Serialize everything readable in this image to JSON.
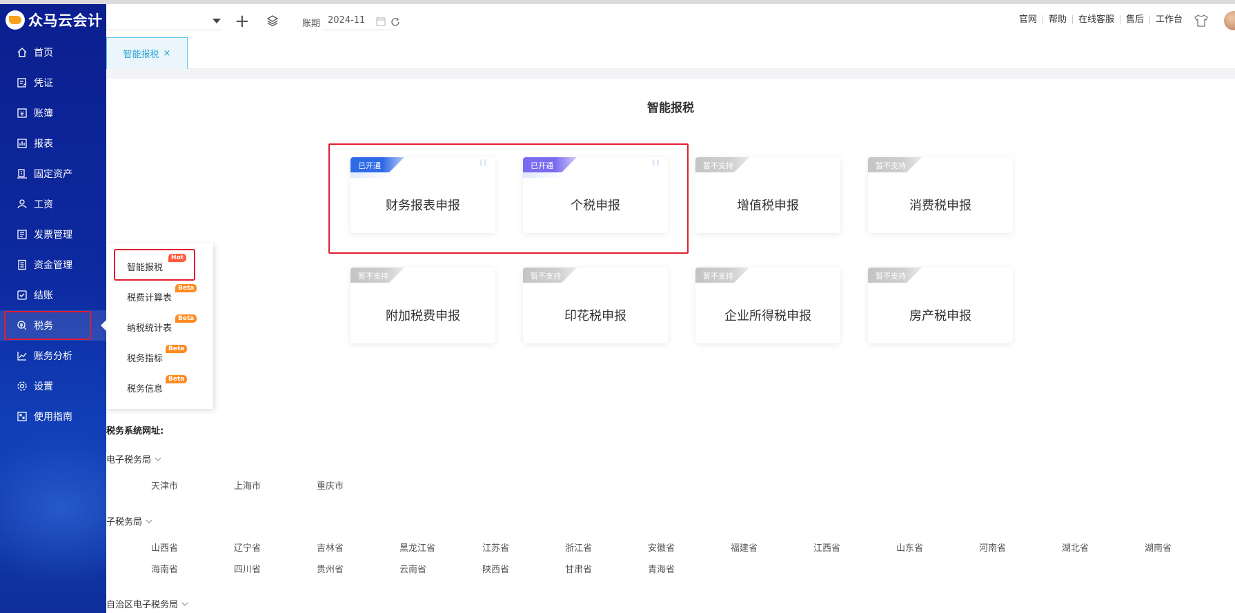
{
  "app": {
    "brand": "众马云会计"
  },
  "sidebar": {
    "items": [
      {
        "label": "首页",
        "icon": "home-icon"
      },
      {
        "label": "凭证",
        "icon": "voucher-icon"
      },
      {
        "label": "账簿",
        "icon": "ledger-icon"
      },
      {
        "label": "报表",
        "icon": "report-icon"
      },
      {
        "label": "固定资产",
        "icon": "asset-icon"
      },
      {
        "label": "工资",
        "icon": "salary-icon"
      },
      {
        "label": "发票管理",
        "icon": "invoice-icon"
      },
      {
        "label": "资金管理",
        "icon": "fund-icon"
      },
      {
        "label": "结账",
        "icon": "closing-icon"
      },
      {
        "label": "税务",
        "icon": "tax-icon",
        "active": true
      },
      {
        "label": "账务分析",
        "icon": "analysis-icon"
      },
      {
        "label": "设置",
        "icon": "gear-icon"
      },
      {
        "label": "使用指南",
        "icon": "guide-icon"
      }
    ]
  },
  "header": {
    "period_label": "账期",
    "period_value": "2024-11",
    "links": [
      "官网",
      "帮助",
      "在线客服",
      "售后",
      "工作台"
    ]
  },
  "tabs": [
    {
      "label": "智能报税",
      "close": "×"
    }
  ],
  "main": {
    "title": "智能报税",
    "cards": [
      {
        "label": "财务报表申报",
        "status": "已开通"
      },
      {
        "label": "个税申报",
        "status": "已开通"
      },
      {
        "label": "增值税申报",
        "status": "暂不支持"
      },
      {
        "label": "消费税申报",
        "status": "暂不支持"
      },
      {
        "label": "附加税费申报",
        "status": "暂不支持"
      },
      {
        "label": "印花税申报",
        "status": "暂不支持"
      },
      {
        "label": "企业所得税申报",
        "status": "暂不支持"
      },
      {
        "label": "房产税申报",
        "status": "暂不支持"
      }
    ],
    "quote_mark": "\""
  },
  "submenu": {
    "items": [
      {
        "label": "智能报税",
        "tag": "Hot"
      },
      {
        "label": "税费计算表",
        "tag": "Beta"
      },
      {
        "label": "纳税统计表",
        "tag": "Beta"
      },
      {
        "label": "税务指标",
        "tag": "Beta"
      },
      {
        "label": "税务信息",
        "tag": "Beta"
      }
    ]
  },
  "tax_sites": {
    "title": "税务系统网址:",
    "regions": [
      {
        "label": "电子税务局",
        "cities": [
          "天津市",
          "上海市",
          "重庆市"
        ]
      },
      {
        "label": "子税务局",
        "cities": [
          "山西省",
          "辽宁省",
          "吉林省",
          "黑龙江省",
          "江苏省",
          "浙江省",
          "安徽省",
          "福建省",
          "江西省",
          "山东省",
          "河南省",
          "湖北省",
          "湖南省",
          "海南省",
          "四川省",
          "贵州省",
          "云南省",
          "陕西省",
          "甘肃省",
          "青海省"
        ]
      },
      {
        "label": "自治区电子税务局",
        "cities": []
      }
    ]
  }
}
